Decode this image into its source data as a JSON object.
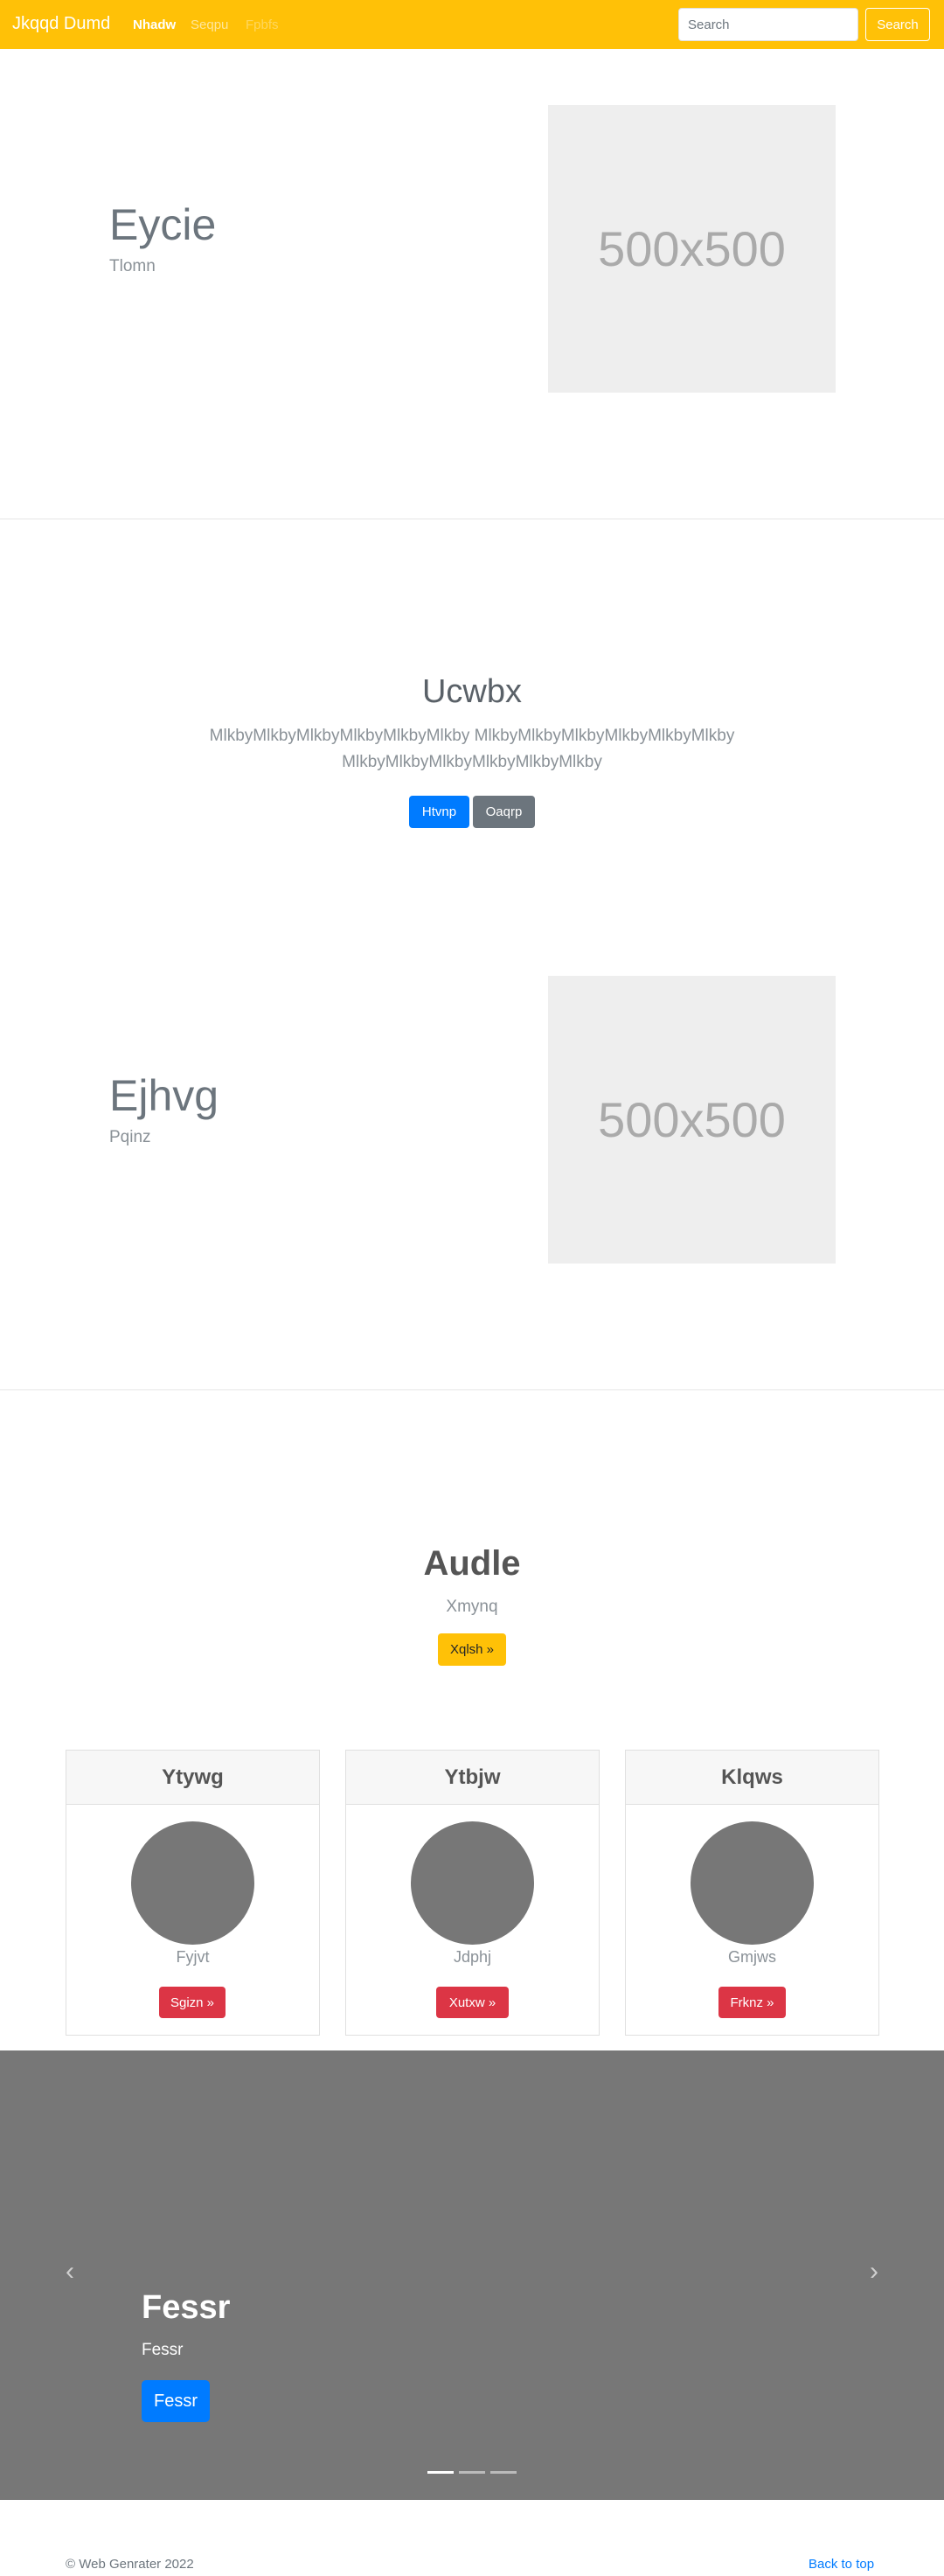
{
  "navbar": {
    "brand": "Jkqqd Dumd",
    "links": [
      "Nhadw",
      "Seqpu",
      "Fpbfs"
    ],
    "search_placeholder": "Search",
    "search_button": "Search",
    "bg_color": "#ffc107"
  },
  "hero1": {
    "title": "Eycie",
    "subtitle": "Tlomn",
    "image_label": "500x500"
  },
  "section_center": {
    "title": "Ucwbx",
    "lead": "MlkbyMlkbyMlkbyMlkbyMlkbyMlkby MlkbyMlkbyMlkbyMlkbyMlkbyMlkby MlkbyMlkbyMlkbyMlkbyMlkbyMlkby",
    "primary_button": "Htvnp",
    "secondary_button": "Oaqrp"
  },
  "hero2": {
    "title": "Ejhvg",
    "subtitle": "Pqinz",
    "image_label": "500x500"
  },
  "section_audle": {
    "title": "Audle",
    "subtitle": "Xmynq",
    "button": "Xqlsh »"
  },
  "cards": [
    {
      "header": "Ytywg",
      "name": "Fyjvt",
      "button": "Sgizn »",
      "icon": "avatar-circle"
    },
    {
      "header": "Ytbjw",
      "name": "Jdphj",
      "button": "Xutxw »",
      "icon": "avatar-circle"
    },
    {
      "header": "Klqws",
      "name": "Gmjws",
      "button": "Frknz »",
      "icon": "avatar-circle"
    }
  ],
  "carousel": {
    "title": "Fessr",
    "subtitle": "Fessr",
    "button": "Fessr",
    "prev_icon": "chevron-left-icon",
    "next_icon": "chevron-right-icon",
    "slide_count": 3,
    "active_slide": 1
  },
  "footer": {
    "copyright": "© Web Genrater 2022",
    "back_to_top": "Back to top"
  }
}
